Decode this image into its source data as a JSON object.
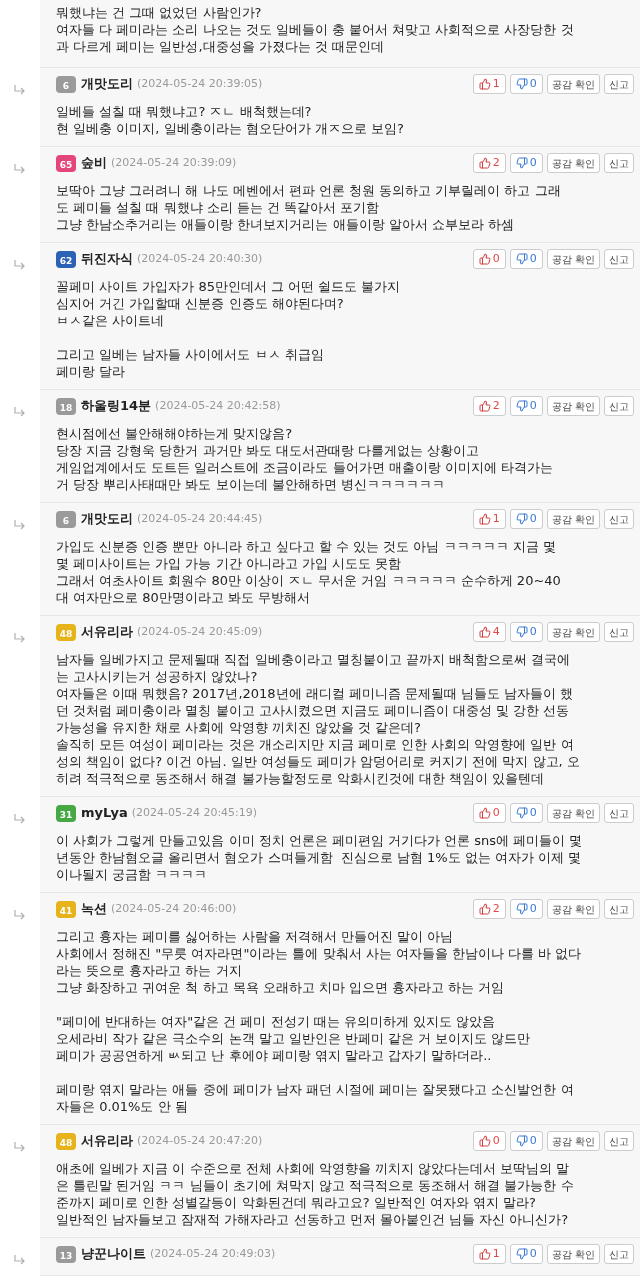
{
  "comments": [
    {
      "kind": "continued",
      "paragraphs": [
        [
          "뭐했냐는 건 그때 없었던 사람인가?",
          "여자들 다 페미라는 소리 나오는 것도 일베들이 충 붙어서 쳐맞고 사회적으로 사장당한 것",
          "과 다르게 페미는 일반성,대중성을 가졌다는 것 때문인데"
        ]
      ]
    },
    {
      "kind": "full",
      "nick": "개맛도리",
      "date": "(2024-05-24 20:39:05)",
      "badge": {
        "level": "6",
        "color": "#9a9a9a"
      },
      "likes": "1",
      "dislikes": "0",
      "buttons": [
        "공감 확인",
        "신고"
      ],
      "paragraphs": [
        [
          "일베들 설칠 때 뭐했냐고? ㅈㄴ 배척했는데?",
          "현 일베충 이미지, 일베충이라는 혐오단어가 개ㅈ으로 보임?"
        ]
      ]
    },
    {
      "kind": "full",
      "nick": "숲비",
      "date": "(2024-05-24 20:39:09)",
      "badge": {
        "level": "65",
        "color": "#e5467a"
      },
      "likes": "2",
      "dislikes": "0",
      "buttons": [
        "공감 확인",
        "신고"
      ],
      "paragraphs": [
        [
          "보딱아 그냥 그러려니 해 나도 메벤에서 편파 언론 청원 동의하고 기부릴레이 하고 그래",
          "도 페미들 설칠 때 뭐했냐 소리 듣는 건 똑같아서 포기함",
          "그냥 한남소추거리는 애들이랑 한녀보지거리는 애들이랑 알아서 쇼부보라 하셈"
        ]
      ]
    },
    {
      "kind": "full",
      "nick": "뒤진자식",
      "date": "(2024-05-24 20:40:30)",
      "badge": {
        "level": "62",
        "color": "#2b62b5"
      },
      "likes": "0",
      "dislikes": "0",
      "buttons": [
        "공감 확인",
        "신고"
      ],
      "paragraphs": [
        [
          "꼴페미 사이트 가입자가 85만인데서 그 어떤 쉴드도 불가지",
          "심지어 거긴 가입할때 신분증 인증도 해야된다며?",
          "ㅂㅅ같은 사이트네"
        ],
        [
          "그리고 일베는 남자들 사이에서도 ㅂㅅ 취급임",
          "페미랑 달라"
        ]
      ]
    },
    {
      "kind": "full",
      "nick": "하울링14분",
      "date": "(2024-05-24 20:42:58)",
      "badge": {
        "level": "18",
        "color": "#9a9a9a"
      },
      "likes": "2",
      "dislikes": "0",
      "buttons": [
        "공감 확인",
        "신고"
      ],
      "paragraphs": [
        [
          "현시점에선 불안해해야하는게 맞지않음?",
          "당장 지금 강형욱 당한거 과거만 봐도 대도서관때랑 다를게없는 상황이고",
          "게임업계에서도 도트든 일러스트에 조금이라도 들어가면 매출이랑 이미지에 타격가는",
          "거 당장 뿌리사태때만 봐도 보이는데 불안해하면 병신ㅋㅋㅋㅋㅋㅋ"
        ]
      ]
    },
    {
      "kind": "full",
      "nick": "개맛도리",
      "date": "(2024-05-24 20:44:45)",
      "badge": {
        "level": "6",
        "color": "#9a9a9a"
      },
      "likes": "1",
      "dislikes": "0",
      "buttons": [
        "공감 확인",
        "신고"
      ],
      "paragraphs": [
        [
          "가입도 신분증 인증 뿐만 아니라 하고 싶다고 할 수 있는 것도 아님 ㅋㅋㅋㅋㅋ 지금 몇",
          "몇 페미사이트는 가입 가능 기간 아니라고 가입 시도도 못함",
          "그래서 여초사이트 회원수 80만 이상이 ㅈㄴ 무서운 거임 ㅋㅋㅋㅋㅋ 순수하게 20~40",
          "대 여자만으로 80만명이라고 봐도 무방해서"
        ]
      ]
    },
    {
      "kind": "full",
      "nick": "서유리라",
      "date": "(2024-05-24 20:45:09)",
      "badge": {
        "level": "48",
        "color": "#e6b31a"
      },
      "likes": "4",
      "dislikes": "0",
      "buttons": [
        "공감 확인",
        "신고"
      ],
      "paragraphs": [
        [
          "남자들 일베가지고 문제될때 직접 일베충이라고 멸칭붙이고 끝까지 배척함으로써 결국에",
          "는 고사시키는거 성공하지 않았나?",
          "여자들은 이때 뭐했음? 2017년,2018년에 래디컬 페미니즘 문제될때 님들도 남자들이 했",
          "던 것처럼 페미충이라 멸칭 붙이고 고사시켰으면 지금도 페미니즘이 대중성 및 강한 선동",
          "가능성을 유지한 채로 사회에 악영향 끼치진 않았을 것 같은데?",
          "솔직히 모든 여성이 페미라는 것은 개소리지만 지금 페미로 인한 사회의 악영향에 일반 여",
          "성의 책임이 없다? 이건 아님. 일반 여성들도 페미가 암덩어리로 커지기 전에 막지 않고, 오",
          "히려 적극적으로 동조해서 해결 불가능할정도로 악화시킨것에 대한 책임이 있을텐데"
        ]
      ]
    },
    {
      "kind": "full",
      "nick": "myLya",
      "date": "(2024-05-24 20:45:19)",
      "badge": {
        "level": "31",
        "color": "#45a845"
      },
      "likes": "0",
      "dislikes": "0",
      "buttons": [
        "공감 확인",
        "신고"
      ],
      "paragraphs": [
        [
          "이 사회가 그렇게 만들고있음 이미 정치 언론은 페미편임 거기다가 언론 sns에 페미들이 몇",
          "년동안 한남혐오글 올리면서 혐오가 스며들게함  진심으로 남혐 1%도 없는 여자가 이제 몇",
          "이나될지 궁금함 ㅋㅋㅋㅋ"
        ]
      ]
    },
    {
      "kind": "full",
      "nick": "녹션",
      "date": "(2024-05-24 20:46:00)",
      "badge": {
        "level": "41",
        "color": "#e6b31a"
      },
      "likes": "2",
      "dislikes": "0",
      "buttons": [
        "공감 확인",
        "신고"
      ],
      "paragraphs": [
        [
          "그리고 흉자는 페미를 싫어하는 사람을 저격해서 만들어진 말이 아님",
          "사회에서 정해진 \"무릇 여자라면\"이라는 틀에 맞춰서 사는 여자들을 한남이나 다를 바 없다",
          "라는 뜻으로 흉자라고 하는 거지",
          "그냥 화장하고 귀여운 척 하고 목욕 오래하고 치마 입으면 흉자라고 하는 거임"
        ],
        [
          "\"페미에 반대하는 여자\"같은 건 페미 전성기 때는 유의미하게 있지도 않았음",
          "오세라비 작가 같은 극소수의 논객 말고 일반인은 반페미 같은 거 보이지도 않드만",
          "페미가 공공연하게 ㅄ되고 난 후에야 페미랑 엮지 말라고 갑자기 말하더라.."
        ],
        [
          "페미랑 엮지 말라는 애들 중에 페미가 남자 패던 시절에 페미는 잘못됐다고 소신발언한 여",
          "자들은 0.01%도 안 됨"
        ]
      ]
    },
    {
      "kind": "full",
      "nick": "서유리라",
      "date": "(2024-05-24 20:47:20)",
      "badge": {
        "level": "48",
        "color": "#e6b31a"
      },
      "likes": "0",
      "dislikes": "0",
      "buttons": [
        "공감 확인",
        "신고"
      ],
      "paragraphs": [
        [
          "애초에 일베가 지금 이 수준으로 전체 사회에 악영향을 끼치지 않았다는데서 보딱님의 말",
          "은 틀린말 된거임 ㅋㅋ 님들이 초기에 쳐막지 않고 적극적으로 동조해서 해결 불가능한 수",
          "준까지 페미로 인한 성별갈등이 악화된건데 뭐라고요? 일반적인 여자와 엮지 말라?",
          "일반적인 남자들보고 잠재적 가해자라고 선동하고 먼저 몰아붙인건 님들 자신 아니신가?"
        ]
      ]
    },
    {
      "kind": "full",
      "nick": "냥꾼나이트",
      "date": "(2024-05-24 20:49:03)",
      "badge": {
        "level": "13",
        "color": "#9a9a9a"
      },
      "likes": "1",
      "dislikes": "0",
      "buttons": [
        "공감 확인",
        "신고"
      ]
    }
  ]
}
